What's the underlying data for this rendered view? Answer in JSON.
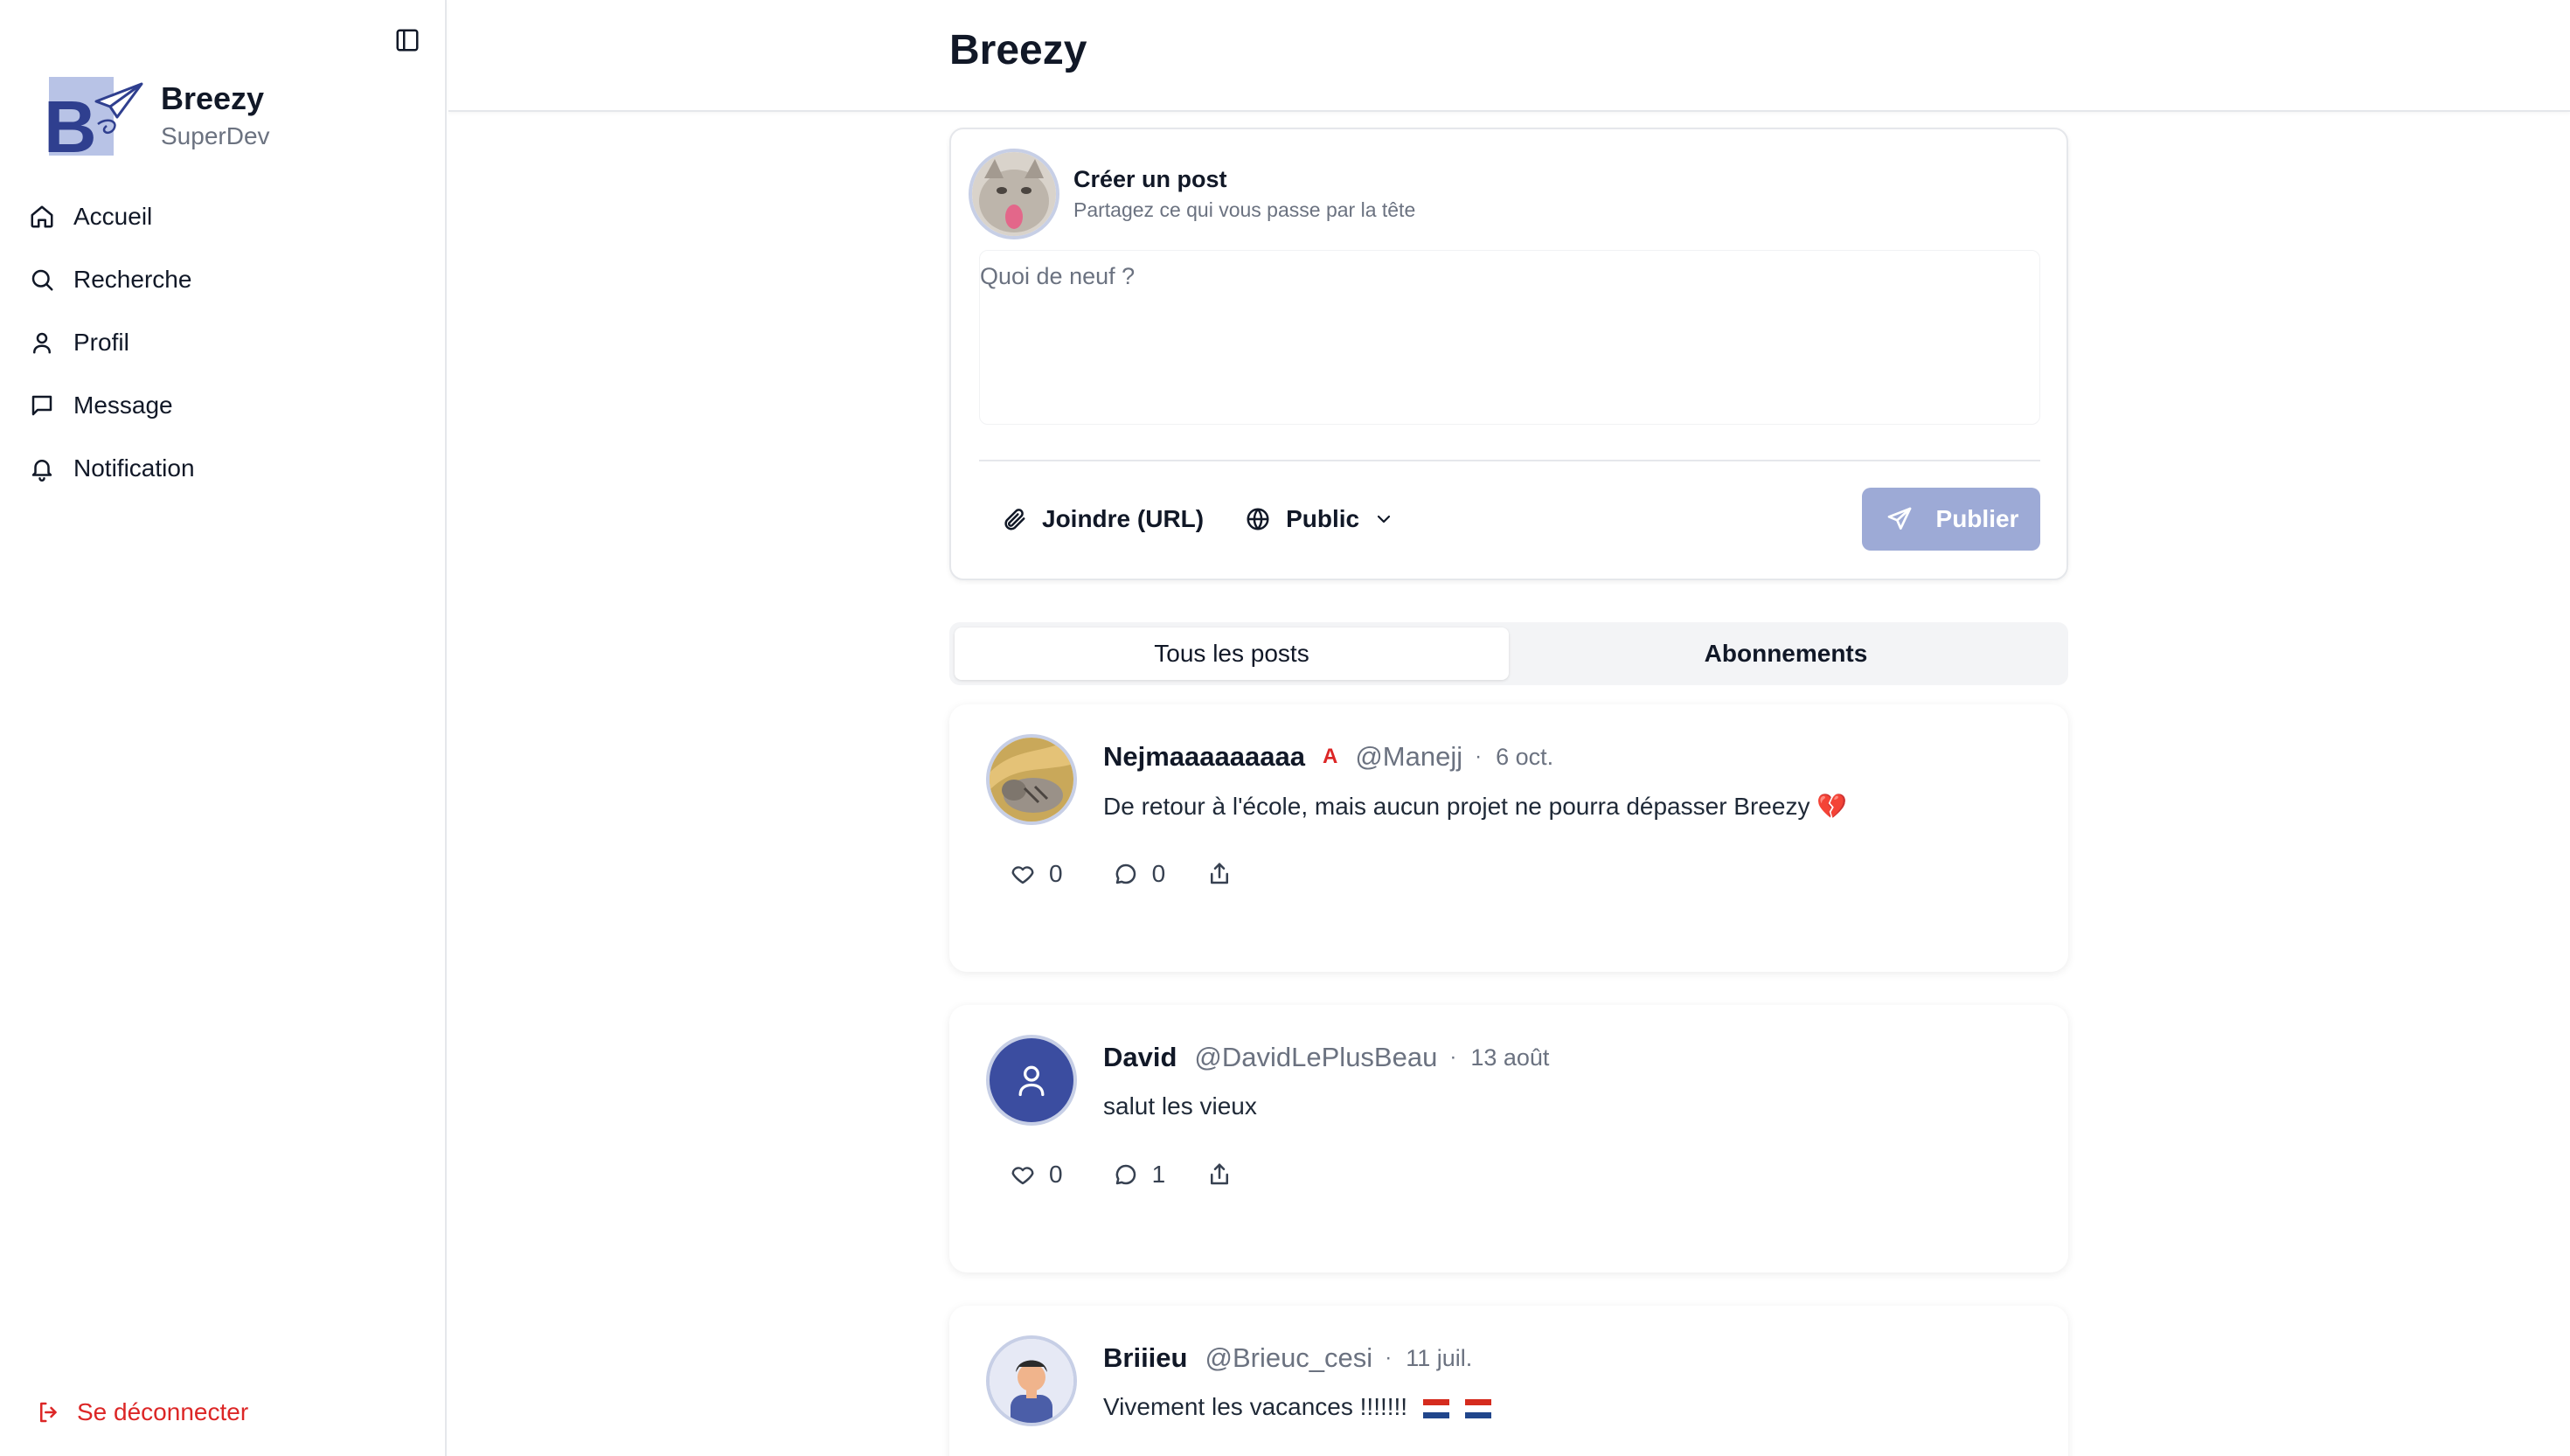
{
  "app": {
    "name": "Breezy",
    "subtitle": "SuperDev",
    "logo_letter": "B"
  },
  "sidebar": {
    "items": [
      {
        "label": "Accueil",
        "icon": "home-icon"
      },
      {
        "label": "Recherche",
        "icon": "search-icon"
      },
      {
        "label": "Profil",
        "icon": "user-icon"
      },
      {
        "label": "Message",
        "icon": "message-icon"
      },
      {
        "label": "Notification",
        "icon": "bell-icon"
      }
    ],
    "logout_label": "Se déconnecter"
  },
  "header": {
    "title": "Breezy"
  },
  "composer": {
    "title": "Créer un post",
    "subtitle": "Partagez ce qui vous passe par la tête",
    "placeholder": "Quoi de neuf ?",
    "attach_label": "Joindre (URL)",
    "visibility_label": "Public",
    "publish_label": "Publier"
  },
  "tabs": [
    {
      "label": "Tous les posts",
      "active": true
    },
    {
      "label": "Abonnements",
      "active": false
    }
  ],
  "posts": [
    {
      "author": "Nejmaaaaaaaaa",
      "badge": "A",
      "handle": "@Manejj",
      "separator": "·",
      "date": "6 oct.",
      "text": "De retour à l'école, mais aucun projet ne pourra dépasser Breezy 💔",
      "likes": "0",
      "comments": "0"
    },
    {
      "author": "David",
      "handle": "@DavidLePlusBeau",
      "separator": "·",
      "date": "13 août",
      "text": "salut les vieux",
      "likes": "0",
      "comments": "1"
    },
    {
      "author": "Briiieu",
      "handle": "@Brieuc_cesi",
      "separator": "·",
      "date": "11 juil.",
      "text": "Vivement les vacances !!!!!!!"
    }
  ],
  "colors": {
    "accent": "#3b4da0",
    "publish_bg": "#9daad6",
    "danger": "#dc2626",
    "muted": "#6b7280"
  }
}
